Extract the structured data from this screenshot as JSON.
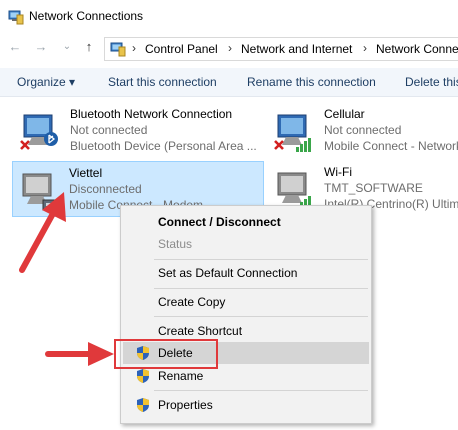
{
  "window": {
    "title": "Network Connections"
  },
  "address": {
    "crumbs": [
      "Control Panel",
      "Network and Internet",
      "Network Connections"
    ]
  },
  "toolbar": {
    "organize": "Organize ▾",
    "start": "Start this connection",
    "rename": "Rename this connection",
    "delete": "Delete this"
  },
  "connections": [
    {
      "name": "Bluetooth Network Connection",
      "status": "Not connected",
      "device": "Bluetooth Device (Personal Area ..."
    },
    {
      "name": "Cellular",
      "status": "Not connected",
      "device": "Mobile Connect - Network"
    },
    {
      "name": "Viettel",
      "status": "Disconnected",
      "device": "Mobile Connect - Modem"
    },
    {
      "name": "Wi-Fi",
      "status": "TMT_SOFTWARE",
      "device": "Intel(R) Centrino(R) Ultimate"
    }
  ],
  "context_menu": {
    "items": [
      {
        "label": "Connect / Disconnect"
      },
      {
        "label": "Status"
      },
      {
        "label": "Set as Default Connection"
      },
      {
        "label": "Create Copy"
      },
      {
        "label": "Create Shortcut"
      },
      {
        "label": "Delete"
      },
      {
        "label": "Rename"
      },
      {
        "label": "Properties"
      }
    ]
  },
  "colors": {
    "highlight": "#e0393b",
    "selection": "#cce8ff",
    "link": "#1e3e64"
  }
}
